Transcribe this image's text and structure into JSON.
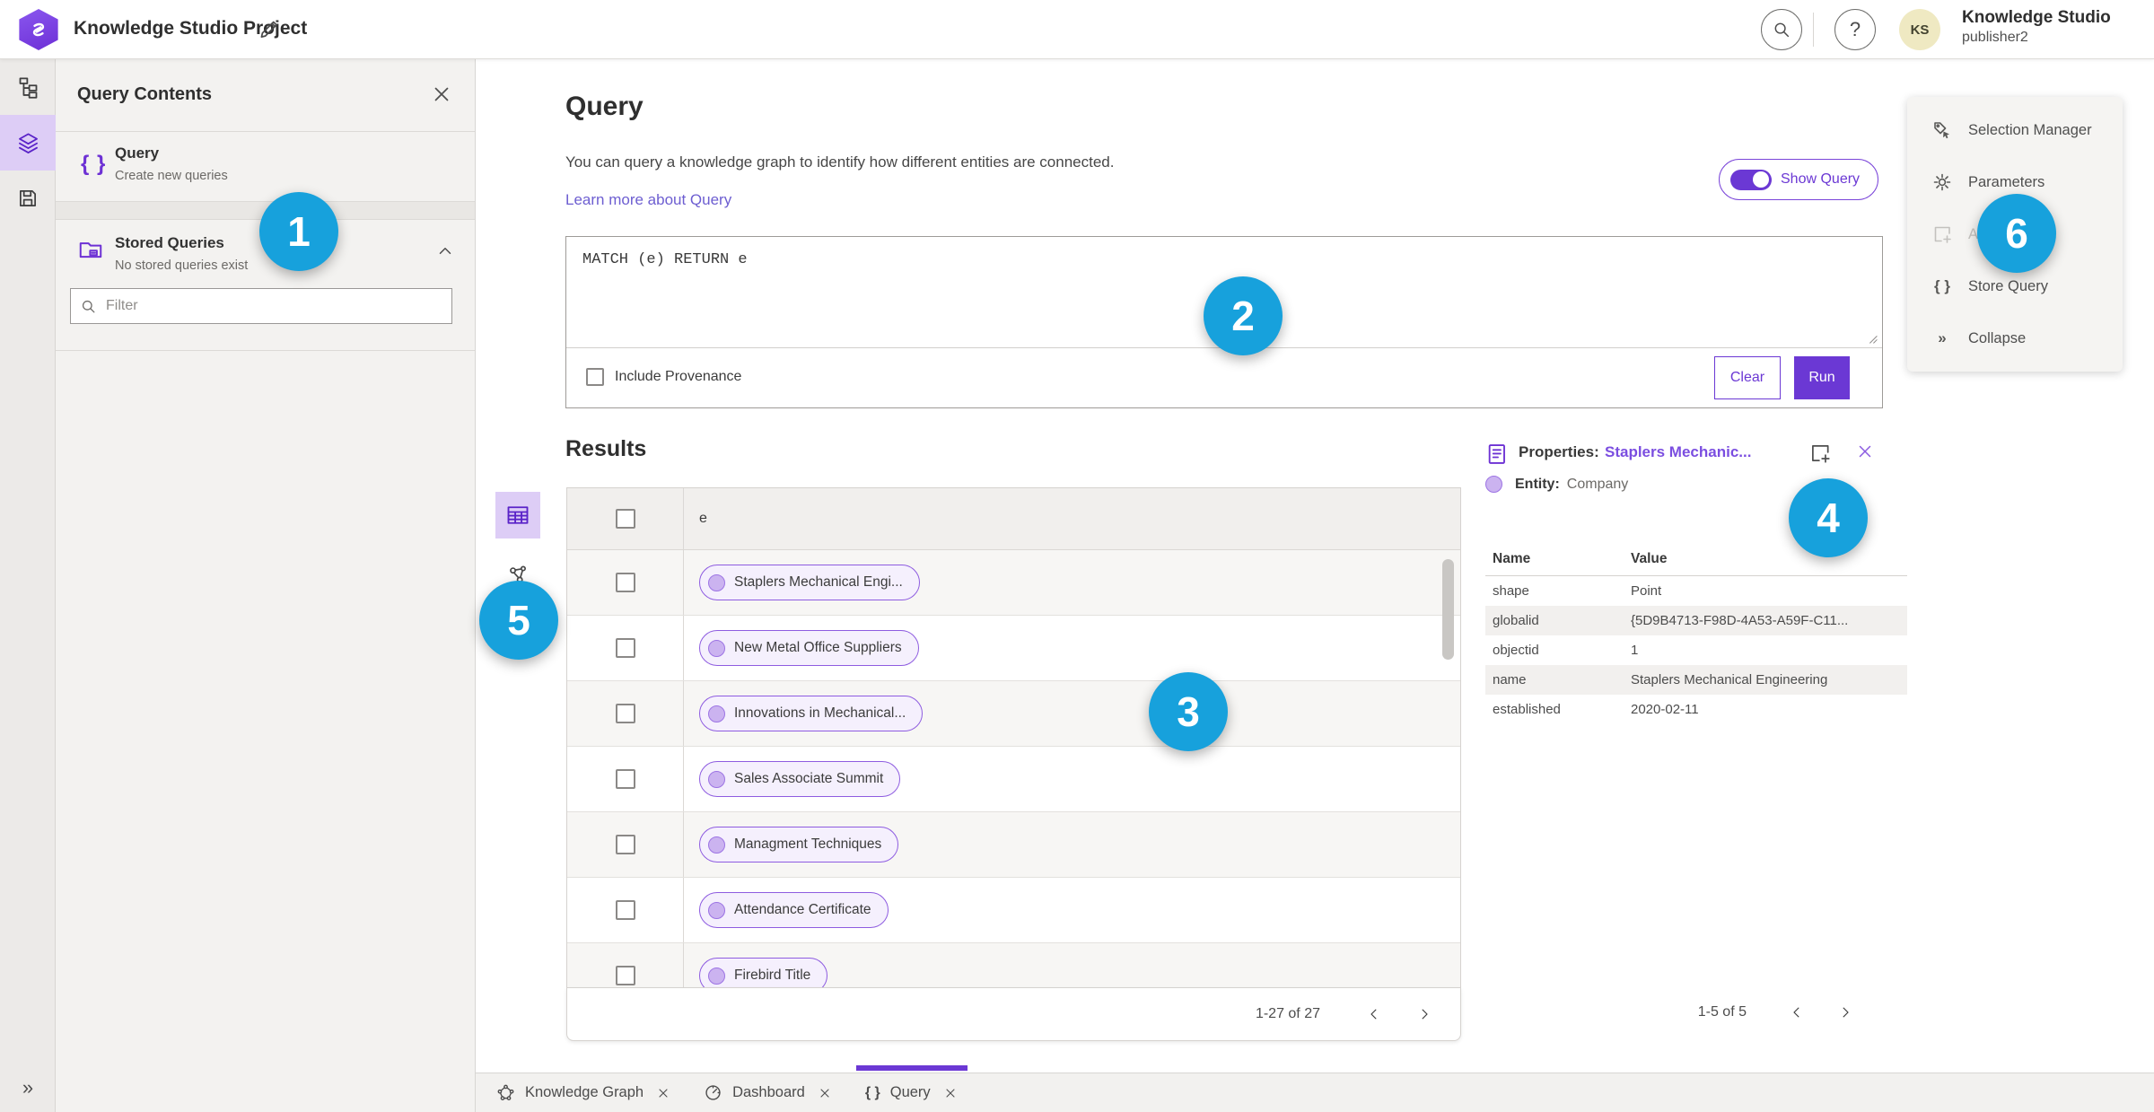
{
  "colors": {
    "accent": "#6b38d4",
    "accent-icon": "#6d31d4",
    "badge": "#17a1dc",
    "link": "#6d5ed1",
    "props-link": "#7b4ee0",
    "pill-border": "#8e5ce0",
    "pill-bg": "#f5f0fd",
    "pill-dot": "#cbb3f0",
    "avatar": "#efe9c2",
    "rail-sel": "#ddcdf6"
  },
  "icons": {
    "braces": "{ }",
    "question": "?",
    "collapse": "»",
    "expand_rail": "»"
  },
  "topbar": {
    "title": "Knowledge Studio Project",
    "user_name": "Knowledge Studio",
    "user_role": "publisher2",
    "avatar_initials": "KS"
  },
  "contents_panel": {
    "title": "Query Contents",
    "query_item": {
      "title": "Query",
      "subtitle": "Create new queries"
    },
    "stored_item": {
      "title": "Stored Queries",
      "subtitle": "No stored queries exist"
    },
    "filter_placeholder": "Filter"
  },
  "query_section": {
    "title": "Query",
    "description": "You can query a knowledge graph to identify how different entities are connected.",
    "learn_more": "Learn more about Query",
    "show_query_label": "Show Query",
    "query_text": "MATCH (e) RETURN e",
    "include_provenance_label": "Include Provenance",
    "clear_label": "Clear",
    "run_label": "Run"
  },
  "results": {
    "title": "Results",
    "column_header": "e",
    "rows": [
      {
        "label": "Staplers Mechanical Engi..."
      },
      {
        "label": "New Metal Office Suppliers"
      },
      {
        "label": "Innovations in Mechanical..."
      },
      {
        "label": "Sales Associate Summit"
      },
      {
        "label": "Managment Techniques"
      },
      {
        "label": "Attendance Certificate"
      },
      {
        "label": "Firebird Title"
      }
    ],
    "pagination": "1-27 of 27"
  },
  "properties_panel": {
    "label": "Properties:",
    "entity_link": "Staplers Mechanic...",
    "entity_label": "Entity:",
    "entity_type": "Company",
    "name_header": "Name",
    "value_header": "Value",
    "rows": [
      {
        "name": "shape",
        "value": "Point"
      },
      {
        "name": "globalid",
        "value": "{5D9B4713-F98D-4A53-A59F-C11..."
      },
      {
        "name": "objectid",
        "value": "1"
      },
      {
        "name": "name",
        "value": "Staplers Mechanical Engineering"
      },
      {
        "name": "established",
        "value": "2020-02-11"
      }
    ],
    "pagination": "1-5 of 5"
  },
  "right_menu": {
    "items": [
      {
        "label": "Selection Manager"
      },
      {
        "label": "Parameters"
      },
      {
        "label": "Add"
      },
      {
        "label": "Store Query"
      },
      {
        "label": "Collapse"
      }
    ]
  },
  "bottom_tabs": [
    {
      "label": "Knowledge Graph"
    },
    {
      "label": "Dashboard"
    },
    {
      "label": "Query"
    }
  ],
  "badges": [
    "1",
    "2",
    "3",
    "4",
    "5",
    "6"
  ]
}
